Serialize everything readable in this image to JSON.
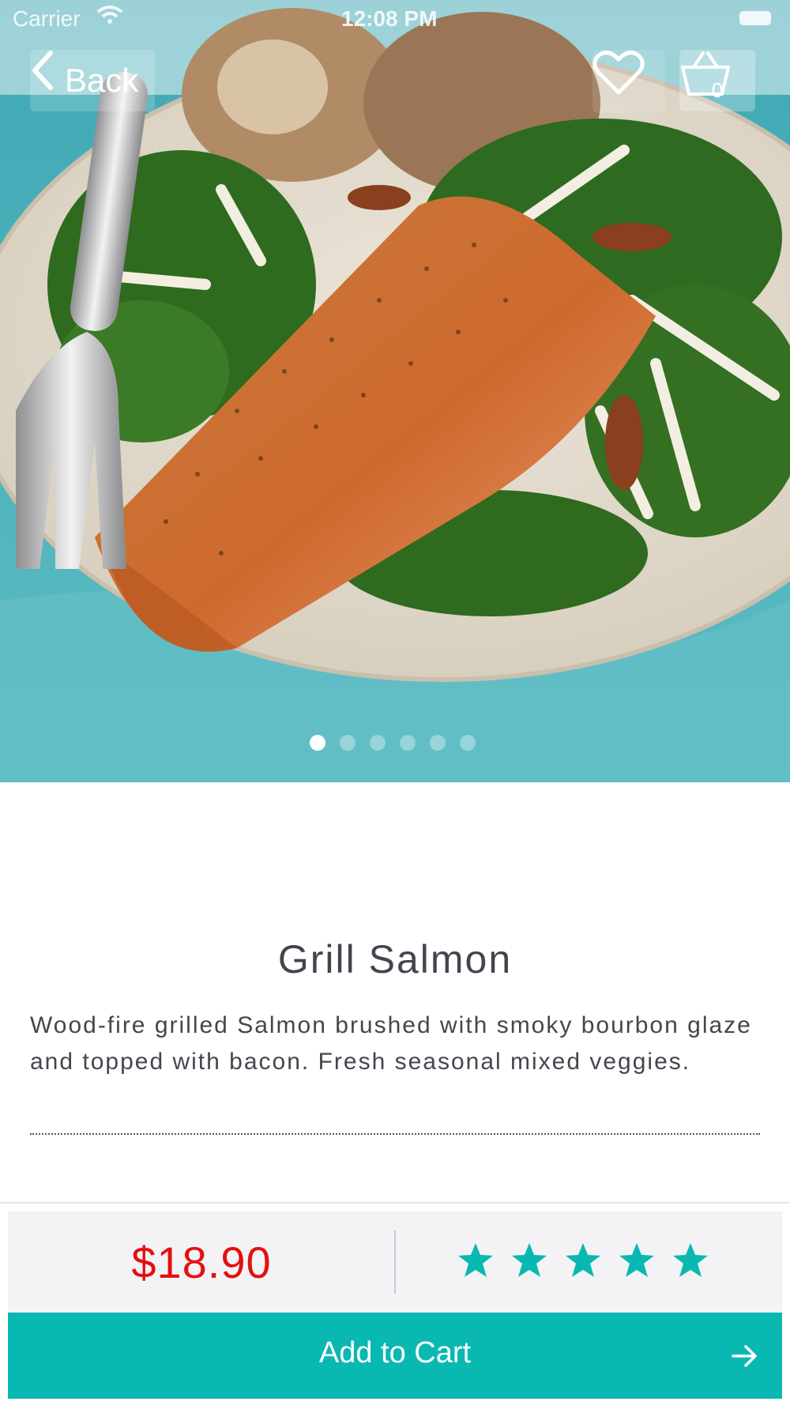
{
  "status_bar": {
    "carrier": "Carrier",
    "time": "12:08 PM",
    "wifi_icon": "wifi-icon",
    "battery_icon": "battery-icon"
  },
  "nav": {
    "back_label": "Back",
    "favorite_icon": "heart-icon",
    "cart_icon": "basket-icon",
    "cart_count": "0"
  },
  "gallery": {
    "image": "grilled-salmon-photo",
    "dot_count": 6,
    "active_index": 0
  },
  "product": {
    "name": "Grill Salmon",
    "description": "Wood-fire grilled Salmon brushed with smoky bourbon glaze and topped with bacon. Fresh seasonal mixed veggies.",
    "price": "$18.90",
    "rating": 5,
    "rating_max": 5
  },
  "actions": {
    "add_to_cart_label": "Add to Cart",
    "arrow_icon": "arrow-right-icon"
  },
  "colors": {
    "accent": "#0ab8b2",
    "price": "#e60f0f",
    "star": "#0ab8b2",
    "text": "#44444f"
  }
}
